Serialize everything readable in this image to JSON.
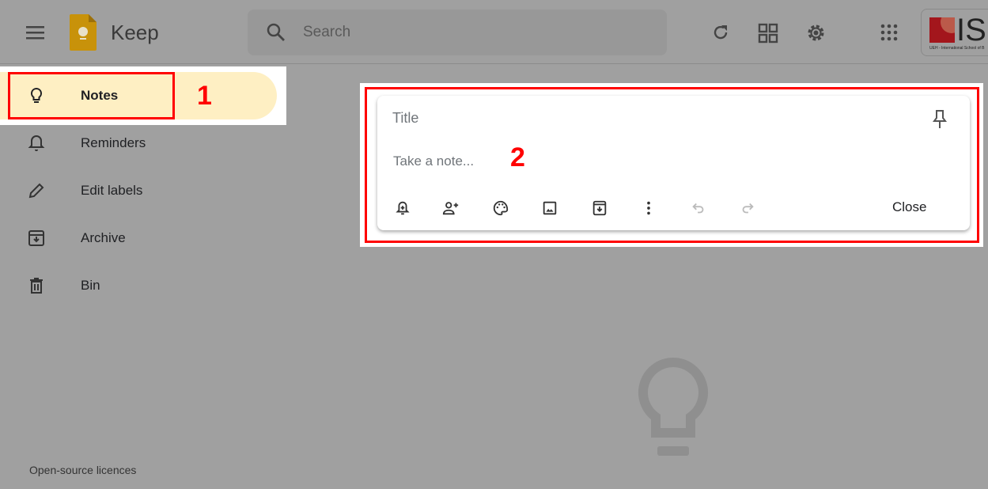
{
  "header": {
    "app_name": "Keep",
    "search_placeholder": "Search",
    "org_logo_text": "IS",
    "org_logo_caption": "UEH - International School of B"
  },
  "sidebar": {
    "items": [
      {
        "label": "Notes",
        "icon": "lightbulb-icon",
        "active": true
      },
      {
        "label": "Reminders",
        "icon": "bell-icon"
      },
      {
        "label": "Edit labels",
        "icon": "pencil-icon"
      },
      {
        "label": "Archive",
        "icon": "archive-icon"
      },
      {
        "label": "Bin",
        "icon": "trash-icon"
      }
    ],
    "footer_link": "Open-source licences"
  },
  "note": {
    "title_placeholder": "Title",
    "body_placeholder": "Take a note...",
    "close_label": "Close"
  },
  "annotations": {
    "marker_1": "1",
    "marker_2": "2"
  },
  "colors": {
    "accent": "#feefc3",
    "annotation": "#ff0000",
    "keep_yellow": "#c8920a"
  }
}
